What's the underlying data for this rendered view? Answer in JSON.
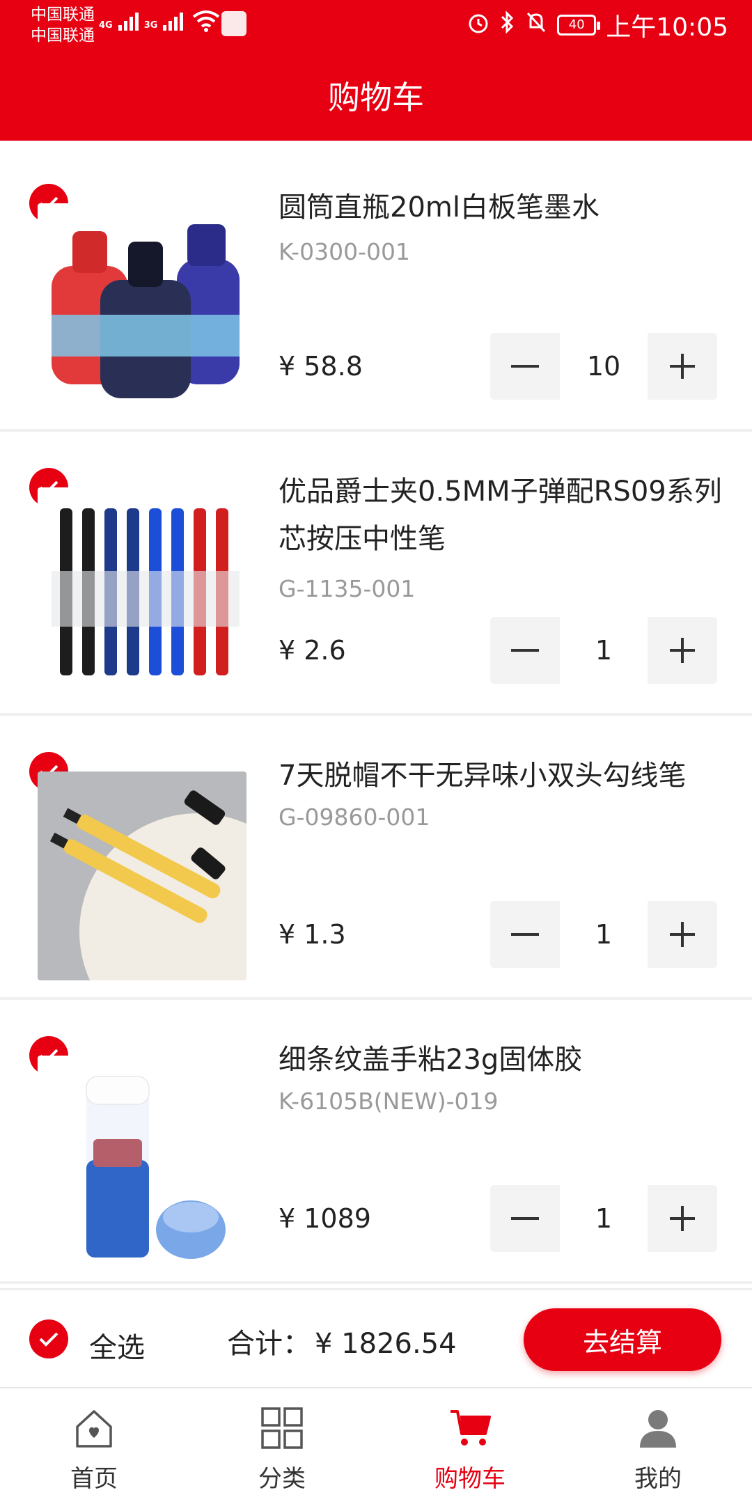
{
  "status_bar": {
    "carrier_1": "中国联通",
    "carrier_2": "中国联通",
    "net_1": "4G",
    "net_2": "3G",
    "battery": "40",
    "time": "上午10:05"
  },
  "header": {
    "title": "购物车"
  },
  "cart": {
    "items": [
      {
        "title": "圆筒直瓶20ml白板笔墨水",
        "sku": "K-0300-001",
        "price": "¥ 58.8",
        "qty": "10"
      },
      {
        "title": "优品爵士夹0.5MM子弹配RS09系列芯按压中性笔",
        "sku": "G-1135-001",
        "price": "¥ 2.6",
        "qty": "1"
      },
      {
        "title": "7天脱帽不干无异味小双头勾线笔",
        "sku": "G-09860-001",
        "price": "¥ 1.3",
        "qty": "1"
      },
      {
        "title": "细条纹盖手粘23g固体胶",
        "sku": "K-6105B(NEW)-019",
        "price": "¥ 1089",
        "qty": "1"
      }
    ]
  },
  "summary": {
    "select_all": "全选",
    "total_label": "合计：",
    "total_amount": "¥ 1826.54",
    "checkout": "去结算"
  },
  "tabbar": {
    "tabs": [
      {
        "label": "首页",
        "icon": "home-icon"
      },
      {
        "label": "分类",
        "icon": "grid-icon"
      },
      {
        "label": "购物车",
        "icon": "cart-icon"
      },
      {
        "label": "我的",
        "icon": "user-icon"
      }
    ],
    "active_index": 2
  },
  "colors": {
    "brand": "#e60012",
    "muted": "#999999"
  }
}
